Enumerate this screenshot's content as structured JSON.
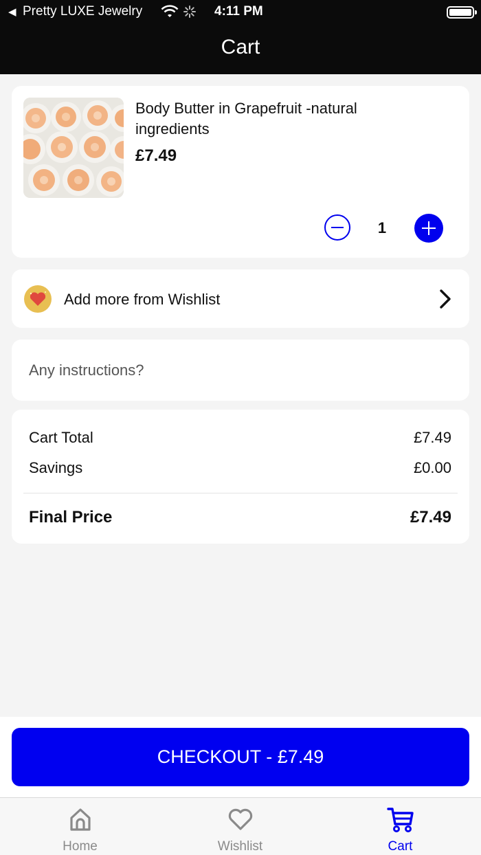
{
  "status_bar": {
    "back_label": "Pretty LUXE Jewelry",
    "time": "4:11 PM"
  },
  "header": {
    "title": "Cart"
  },
  "cart_item": {
    "name": "Body Butter in Grapefruit -natural ingredients",
    "price": "£7.49",
    "quantity": "1",
    "image_icon": "body-butter-jars-photo"
  },
  "wishlist_row": {
    "label": "Add more from Wishlist"
  },
  "instructions": {
    "placeholder": "Any instructions?"
  },
  "totals": {
    "cart_total_label": "Cart Total",
    "cart_total_value": "£7.49",
    "savings_label": "Savings",
    "savings_value": "£0.00",
    "final_label": "Final Price",
    "final_value": "£7.49"
  },
  "checkout": {
    "label": "CHECKOUT - £7.49"
  },
  "tabs": [
    {
      "label": "Home",
      "icon": "home-icon"
    },
    {
      "label": "Wishlist",
      "icon": "heart-icon"
    },
    {
      "label": "Cart",
      "icon": "cart-icon",
      "active": true
    }
  ],
  "colors": {
    "accent": "#0000ee",
    "header_bg": "#0b0b0b",
    "page_bg": "#f4f4f4"
  }
}
